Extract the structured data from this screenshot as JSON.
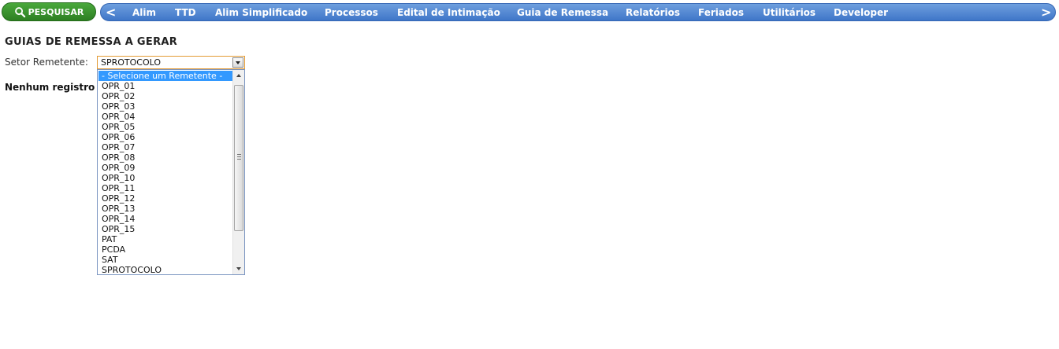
{
  "toolbar": {
    "search_label": "PESQUISAR",
    "search_icon": "magnifier-icon"
  },
  "nav": {
    "prev_arrow": "<",
    "next_arrow": ">",
    "items": [
      "Alim",
      "TTD",
      "Alim Simplificado",
      "Processos",
      "Edital de Intimação",
      "Guia de Remessa",
      "Relatórios",
      "Feriados",
      "Utilitários",
      "Developer"
    ]
  },
  "page": {
    "title": "GUIAS DE REMESSA A GERAR",
    "setor_label": "Setor Remetente:",
    "no_records": "Nenhum registro e"
  },
  "select": {
    "value": "SPROTOCOLO",
    "options": [
      "- Selecione um Remetente -",
      "OPR_01",
      "OPR_02",
      "OPR_03",
      "OPR_04",
      "OPR_05",
      "OPR_06",
      "OPR_07",
      "OPR_08",
      "OPR_09",
      "OPR_10",
      "OPR_11",
      "OPR_12",
      "OPR_13",
      "OPR_14",
      "OPR_15",
      "PAT",
      "PCDA",
      "SAT",
      "SPROTOCOLO"
    ],
    "highlighted_index": 0
  },
  "colors": {
    "search_green": "#2d7f22",
    "nav_blue": "#3f76c8",
    "highlight": "#3399ff",
    "select_border": "#e39b34"
  }
}
